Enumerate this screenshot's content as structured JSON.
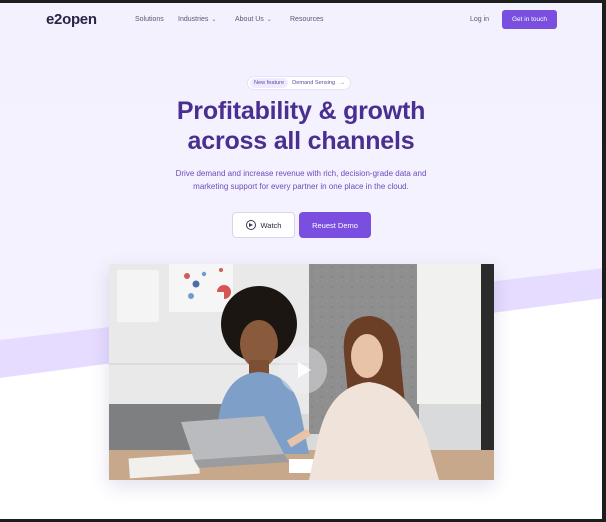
{
  "nav": {
    "logo": "e2open",
    "items": [
      {
        "label": "Solutions",
        "dropdown": false
      },
      {
        "label": "Industries",
        "dropdown": true
      },
      {
        "label": "About Us",
        "dropdown": true
      },
      {
        "label": "Resources",
        "dropdown": false
      }
    ],
    "login": "Log in",
    "cta": "Get in touch"
  },
  "hero": {
    "badge_pill": "New feature",
    "badge_text": "Demand Sensing",
    "badge_arrow_icon": "arrow-right-icon",
    "title_line1": "Profitability & growth",
    "title_line2": "across all channels",
    "subtitle_line1": "Drive demand and increase revenue with rich, decision-grade data and",
    "subtitle_line2": "marketing support for every partner in one place in the cloud.",
    "watch_label": "Watch",
    "demo_label": "Reuest Demo"
  },
  "colors": {
    "accent": "#7a4fe0",
    "heading": "#4a2f91",
    "subtext": "#6b4cbb",
    "hero_bg": "#f4f1ff",
    "band": "#e6dcff"
  },
  "media": {
    "icon": "play-icon",
    "alt_scene": "two women at a laptop"
  }
}
